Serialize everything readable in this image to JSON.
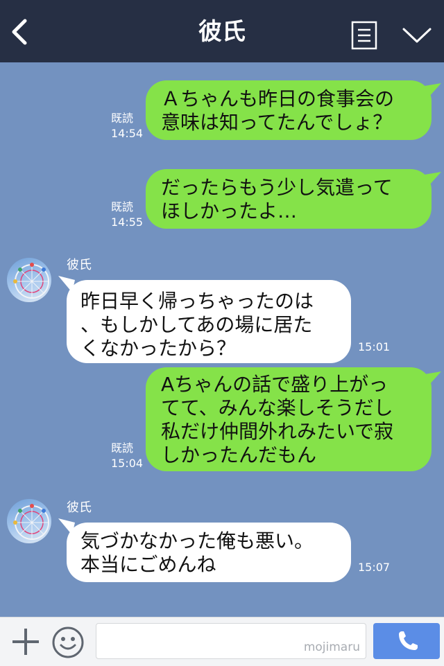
{
  "header": {
    "title": "彼氏"
  },
  "messages": [
    {
      "type": "sent",
      "text": "Ａちゃんも昨日の食事会の\n意味は知ってたんでしょ？",
      "read": "既読",
      "time": "14:54"
    },
    {
      "type": "sent",
      "text": "だったらもう少し気遣って\nほしかったよ…",
      "read": "既読",
      "time": "14:55"
    },
    {
      "type": "received",
      "sender": "彼氏",
      "text": "昨日早く帰っちゃったのは\n、もしかしてあの場に居た\nくなかったから？",
      "time": "15:01"
    },
    {
      "type": "sent",
      "text": "Aちゃんの話で盛り上がっ\nてて、みんな楽しそうだし\n私だけ仲間外れみたいで寂\nしかったんだもん",
      "read": "既読",
      "time": "15:04"
    },
    {
      "type": "received",
      "sender": "彼氏",
      "text": "気づかなかった俺も悪い。\n本当にごめんね",
      "time": "15:07"
    }
  ],
  "input": {
    "placeholder": "",
    "watermark": "mojimaru"
  },
  "icons": {
    "back": "chevron-left-icon",
    "menu": "list-icon",
    "dropdown": "chevron-down-icon",
    "add": "plus-icon",
    "emoji": "smiley-icon",
    "call": "phone-icon"
  },
  "colors": {
    "header": "#262f44",
    "background": "#7392c0",
    "sent_bubble": "#85e249",
    "received_bubble": "#ffffff",
    "call_button": "#5b8de6"
  }
}
